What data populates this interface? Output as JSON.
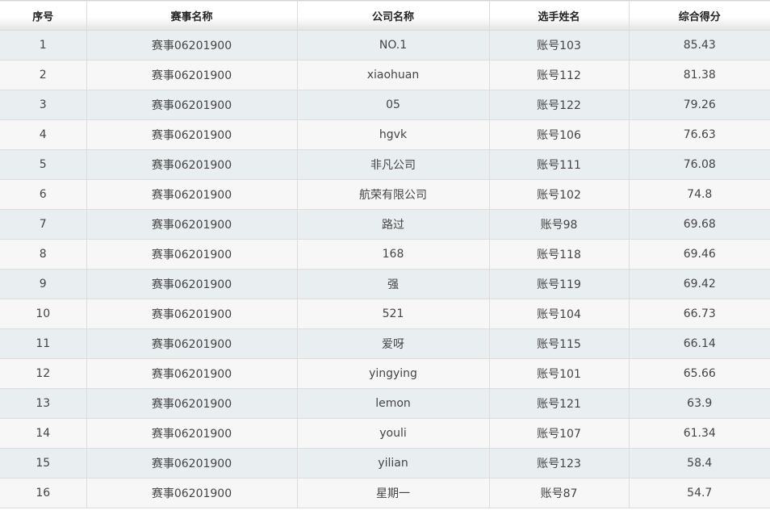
{
  "table": {
    "columns": [
      "序号",
      "赛事名称",
      "公司名称",
      "选手姓名",
      "综合得分"
    ],
    "rows": [
      [
        "1",
        "赛事06201900",
        "NO.1",
        "账号103",
        "85.43"
      ],
      [
        "2",
        "赛事06201900",
        "xiaohuan",
        "账号112",
        "81.38"
      ],
      [
        "3",
        "赛事06201900",
        "05",
        "账号122",
        "79.26"
      ],
      [
        "4",
        "赛事06201900",
        "hgvk",
        "账号106",
        "76.63"
      ],
      [
        "5",
        "赛事06201900",
        "非凡公司",
        "账号111",
        "76.08"
      ],
      [
        "6",
        "赛事06201900",
        "航荣有限公司",
        "账号102",
        "74.8"
      ],
      [
        "7",
        "赛事06201900",
        "路过",
        "账号98",
        "69.68"
      ],
      [
        "8",
        "赛事06201900",
        "168",
        "账号118",
        "69.46"
      ],
      [
        "9",
        "赛事06201900",
        "强",
        "账号119",
        "69.42"
      ],
      [
        "10",
        "赛事06201900",
        "521",
        "账号104",
        "66.73"
      ],
      [
        "11",
        "赛事06201900",
        "爱呀",
        "账号115",
        "66.14"
      ],
      [
        "12",
        "赛事06201900",
        "yingying",
        "账号101",
        "65.66"
      ],
      [
        "13",
        "赛事06201900",
        "lemon",
        "账号121",
        "63.9"
      ],
      [
        "14",
        "赛事06201900",
        "youli",
        "账号107",
        "61.34"
      ],
      [
        "15",
        "赛事06201900",
        "yilian",
        "账号123",
        "58.4"
      ],
      [
        "16",
        "赛事06201900",
        "星期一",
        "账号87",
        "54.7"
      ]
    ]
  },
  "colors": {
    "row_odd": "#e9eef0",
    "row_even": "#f7f7f7",
    "border": "#dcdcdc"
  }
}
